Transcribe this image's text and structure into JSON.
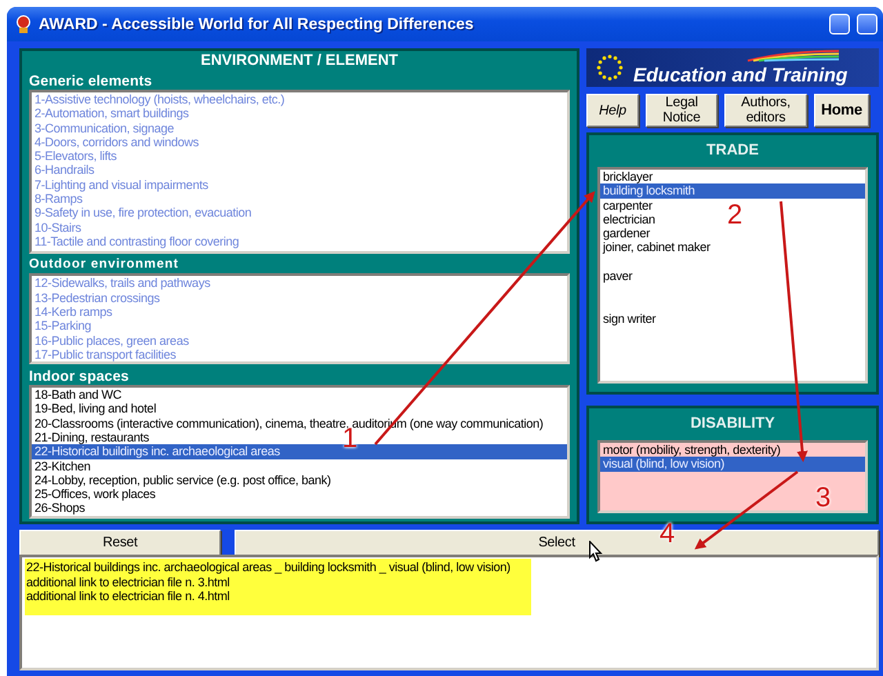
{
  "window": {
    "title": "AWARD - Accessible World for All Respecting Differences"
  },
  "environment": {
    "title": "ENVIRONMENT / ELEMENT",
    "sections": [
      {
        "title": "Generic elements",
        "disabled": true,
        "items": [
          {
            "label": "1-Assistive technology (hoists, wheelchairs, etc.)",
            "selected": false
          },
          {
            "label": "2-Automation, smart buildings",
            "selected": false
          },
          {
            "label": "3-Communication, signage",
            "selected": false
          },
          {
            "label": "4-Doors, corridors and windows",
            "selected": false
          },
          {
            "label": "5-Elevators, lifts",
            "selected": false
          },
          {
            "label": "6-Handrails",
            "selected": false
          },
          {
            "label": "7-Lighting and visual impairments",
            "selected": false
          },
          {
            "label": "8-Ramps",
            "selected": false
          },
          {
            "label": "9-Safety in use, fire protection, evacuation",
            "selected": false
          },
          {
            "label": "10-Stairs",
            "selected": false
          },
          {
            "label": "11-Tactile and contrasting floor covering",
            "selected": false
          }
        ]
      },
      {
        "title": "Outdoor environment",
        "disabled": true,
        "items": [
          {
            "label": "12-Sidewalks, trails and pathways",
            "selected": false
          },
          {
            "label": "13-Pedestrian crossings",
            "selected": false
          },
          {
            "label": "14-Kerb ramps",
            "selected": false
          },
          {
            "label": "15-Parking",
            "selected": false
          },
          {
            "label": "16-Public places, green areas",
            "selected": false
          },
          {
            "label": "17-Public transport facilities",
            "selected": false
          }
        ]
      },
      {
        "title": "Indoor spaces",
        "disabled": false,
        "items": [
          {
            "label": "18-Bath and WC",
            "selected": false
          },
          {
            "label": "19-Bed, living and hotel",
            "selected": false
          },
          {
            "label": "20-Classrooms (interactive communication), cinema, theatre, auditorium (one way communication)",
            "selected": false
          },
          {
            "label": "21-Dining, restaurants",
            "selected": false
          },
          {
            "label": "22-Historical buildings inc. archaeological areas",
            "selected": true
          },
          {
            "label": "23-Kitchen",
            "selected": false
          },
          {
            "label": "24-Lobby, reception, public service (e.g. post office, bank)",
            "selected": false
          },
          {
            "label": "25-Offices, work places",
            "selected": false
          },
          {
            "label": "26-Shops",
            "selected": false
          }
        ]
      }
    ]
  },
  "logo": {
    "text": "Education and Training"
  },
  "nav_buttons": [
    {
      "label": "Help",
      "kind": "italic"
    },
    {
      "label": "Legal Notice",
      "kind": "plain"
    },
    {
      "label": "Authors, editors",
      "kind": "plain"
    },
    {
      "label": "Home",
      "kind": "bold"
    }
  ],
  "trade": {
    "title": "TRADE",
    "items": [
      {
        "kind": "item",
        "label": "bricklayer",
        "selected": false
      },
      {
        "kind": "item",
        "label": "building locksmith",
        "selected": true
      },
      {
        "kind": "item",
        "label": "carpenter",
        "selected": false
      },
      {
        "kind": "item",
        "label": "electrician",
        "selected": false
      },
      {
        "kind": "item",
        "label": "gardener",
        "selected": false
      },
      {
        "kind": "item",
        "label": "joiner, cabinet maker",
        "selected": false
      },
      {
        "kind": "blank",
        "selected": false
      },
      {
        "kind": "item",
        "label": "paver",
        "selected": false
      },
      {
        "kind": "blank",
        "selected": false
      },
      {
        "kind": "blank",
        "selected": false
      },
      {
        "kind": "item",
        "label": "sign writer",
        "selected": false
      }
    ]
  },
  "disability": {
    "title": "DISABILITY",
    "items": [
      {
        "label": "motor (mobility, strength, dexterity)",
        "selected": false
      },
      {
        "label": "visual (blind, low vision)",
        "selected": true
      }
    ]
  },
  "actions": [
    {
      "label": "Reset"
    },
    {
      "label": "Select"
    }
  ],
  "results": [
    "22-Historical buildings inc. archaeological areas _ building locksmith _ visual (blind, low vision)",
    "additional link to electrician file n. 3.html",
    "additional link to electrician file n. 4.html"
  ],
  "annotations": [
    {
      "label": "1"
    },
    {
      "label": "2"
    },
    {
      "label": "3"
    },
    {
      "label": "4"
    }
  ]
}
